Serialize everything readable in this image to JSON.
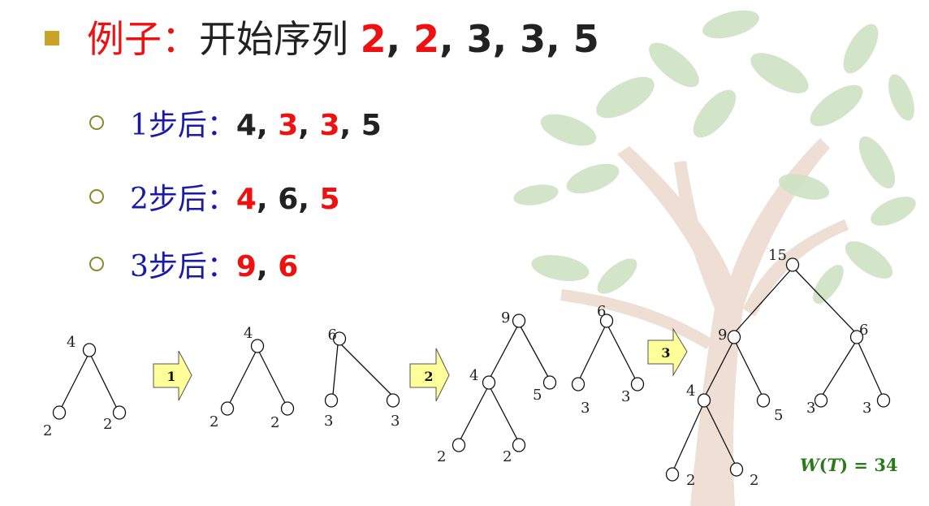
{
  "heading": {
    "label": "例子",
    "colon": "：",
    "text": "开始序列 ",
    "sequence": [
      {
        "v": "2",
        "c": "red"
      },
      {
        "v": "2",
        "c": "red"
      },
      {
        "v": "3",
        "c": "dark"
      },
      {
        "v": "3",
        "c": "dark"
      },
      {
        "v": "5",
        "c": "dark"
      }
    ]
  },
  "steps": [
    {
      "label": "1步后：",
      "values": [
        {
          "v": "4",
          "c": "dark"
        },
        {
          "v": "3",
          "c": "red"
        },
        {
          "v": "3",
          "c": "red"
        },
        {
          "v": "5",
          "c": "dark"
        }
      ]
    },
    {
      "label": "2步后：",
      "values": [
        {
          "v": "4",
          "c": "red"
        },
        {
          "v": "6",
          "c": "dark"
        },
        {
          "v": "5",
          "c": "red"
        }
      ]
    },
    {
      "label": "3步后：",
      "values": [
        {
          "v": "9",
          "c": "red"
        },
        {
          "v": "6",
          "c": "red"
        }
      ]
    }
  ],
  "arrows": [
    "1",
    "2",
    "3"
  ],
  "trees": {
    "t1": {
      "root": "4",
      "left": "2",
      "right": "2"
    },
    "t2a": {
      "root": "4",
      "left": "2",
      "right": "2"
    },
    "t2b": {
      "root": "6",
      "left": "3",
      "right": "3"
    },
    "t3a": {
      "root": "9",
      "mid": "4",
      "right": "5",
      "ll": "2",
      "lr": "2"
    },
    "t3b": {
      "root": "6",
      "left": "3",
      "right": "3"
    },
    "t4": {
      "root": "15",
      "l": "9",
      "r": "6",
      "ll": "4",
      "lr": "5",
      "rl": "3",
      "rr": "3",
      "lll": "2",
      "llr": "2"
    }
  },
  "weight": {
    "w": "W",
    "open": "(",
    "t": "T",
    "close": ")",
    "eq": " = 34"
  },
  "colors": {
    "red": "#ee1111",
    "dark": "#222222",
    "blue": "#1a1aa8",
    "green": "#2a7a1a",
    "arrow_fill": "#ffff99",
    "leaf": "#cfe3c4",
    "trunk": "#ecd9cc"
  }
}
